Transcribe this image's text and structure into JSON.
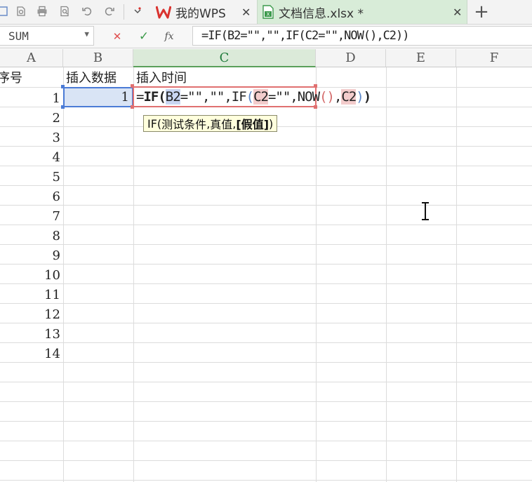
{
  "titlebar": {
    "tabs": [
      {
        "label": "我的WPS",
        "close": "✕",
        "icon": "wps-logo-icon",
        "active": false
      },
      {
        "label": "文档信息.xlsx *",
        "close": "✕",
        "icon": "excel-file-icon",
        "active": true
      }
    ],
    "new_tab": "+"
  },
  "formula_bar": {
    "name_box": "SUM",
    "cancel": "✕",
    "confirm": "✓",
    "fx": "fx",
    "formula": "=IF(B2=\"\",\"\",IF(C2=\"\",NOW(),C2))"
  },
  "columns": [
    "A",
    "B",
    "C",
    "D",
    "E",
    "F"
  ],
  "active_column": "C",
  "header_row": {
    "a": "序号",
    "b": "插入数据",
    "c": "插入时间"
  },
  "row_numbers": [
    "1",
    "2",
    "3",
    "4",
    "5",
    "6",
    "7",
    "8",
    "9",
    "10",
    "11",
    "12",
    "13",
    "14"
  ],
  "b1_value": "1",
  "editing_formula": {
    "eq": "=",
    "fn": "IF",
    "open1": "(",
    "ref1": "B2",
    "mid1": "=\"\",\"\",IF",
    "open2": "(",
    "ref2": "C2",
    "mid2": "=\"\",NOW",
    "paren3": "()",
    "comma": ",",
    "ref3": "C2",
    "close2": ")",
    "close1": ")"
  },
  "tooltip": {
    "fn": "IF",
    "open": " (",
    "arg1": "测试条件",
    "sep1": ", ",
    "arg2": "真值",
    "sep2": ", ",
    "arg3": "[假值]",
    "close": ")"
  },
  "colors": {
    "accent_green": "#5aa05a",
    "selection_blue": "#4b7bd6",
    "edit_red": "#e07070",
    "wps_red": "#d9322e"
  }
}
